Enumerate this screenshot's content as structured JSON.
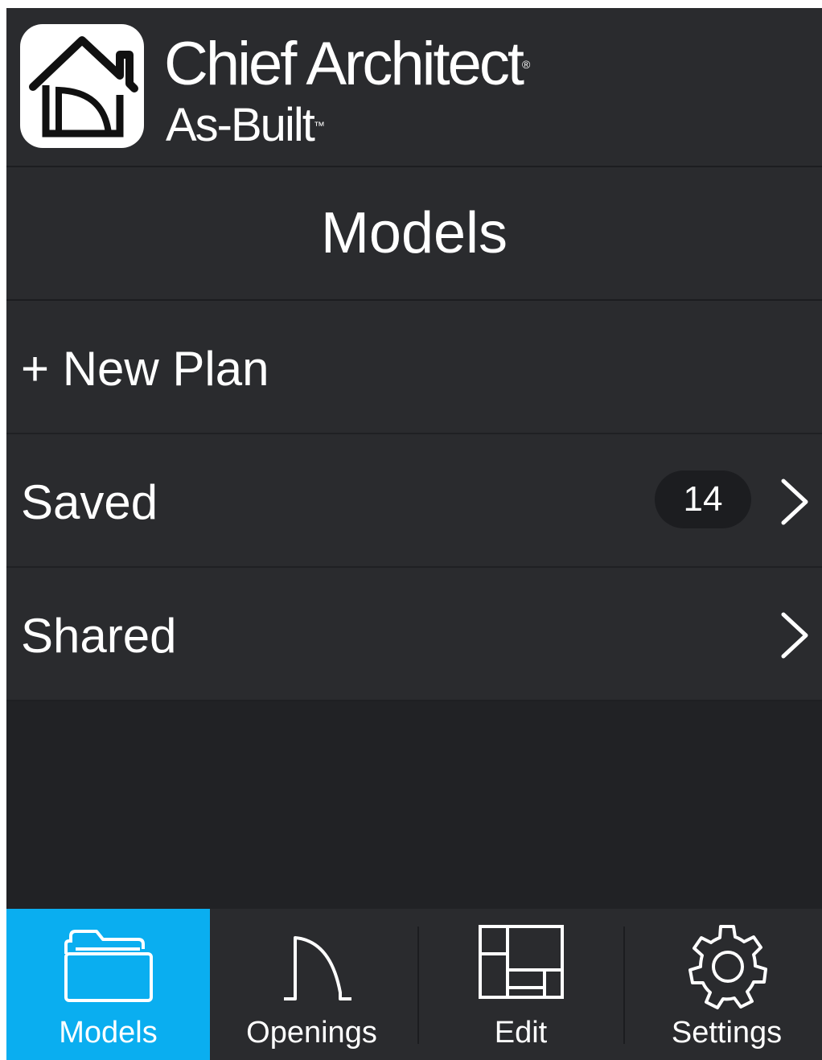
{
  "app": {
    "brand_name": "Chief Architect",
    "brand_sub": "As-Built",
    "trademark_r": "®",
    "trademark_tm": "™"
  },
  "header": {
    "title": "Models"
  },
  "list": {
    "new_plan_label": "+ New Plan",
    "saved_label": "Saved",
    "saved_count": "14",
    "shared_label": "Shared"
  },
  "tabbar": {
    "tabs": [
      {
        "label": "Models",
        "icon": "folder-icon",
        "active": true
      },
      {
        "label": "Openings",
        "icon": "door-swing-icon",
        "active": false
      },
      {
        "label": "Edit",
        "icon": "floorplan-icon",
        "active": false
      },
      {
        "label": "Settings",
        "icon": "gear-icon",
        "active": false
      }
    ]
  },
  "colors": {
    "background": "#212225",
    "row": "#2a2b2e",
    "accent": "#0aaef0",
    "text": "#ffffff"
  }
}
